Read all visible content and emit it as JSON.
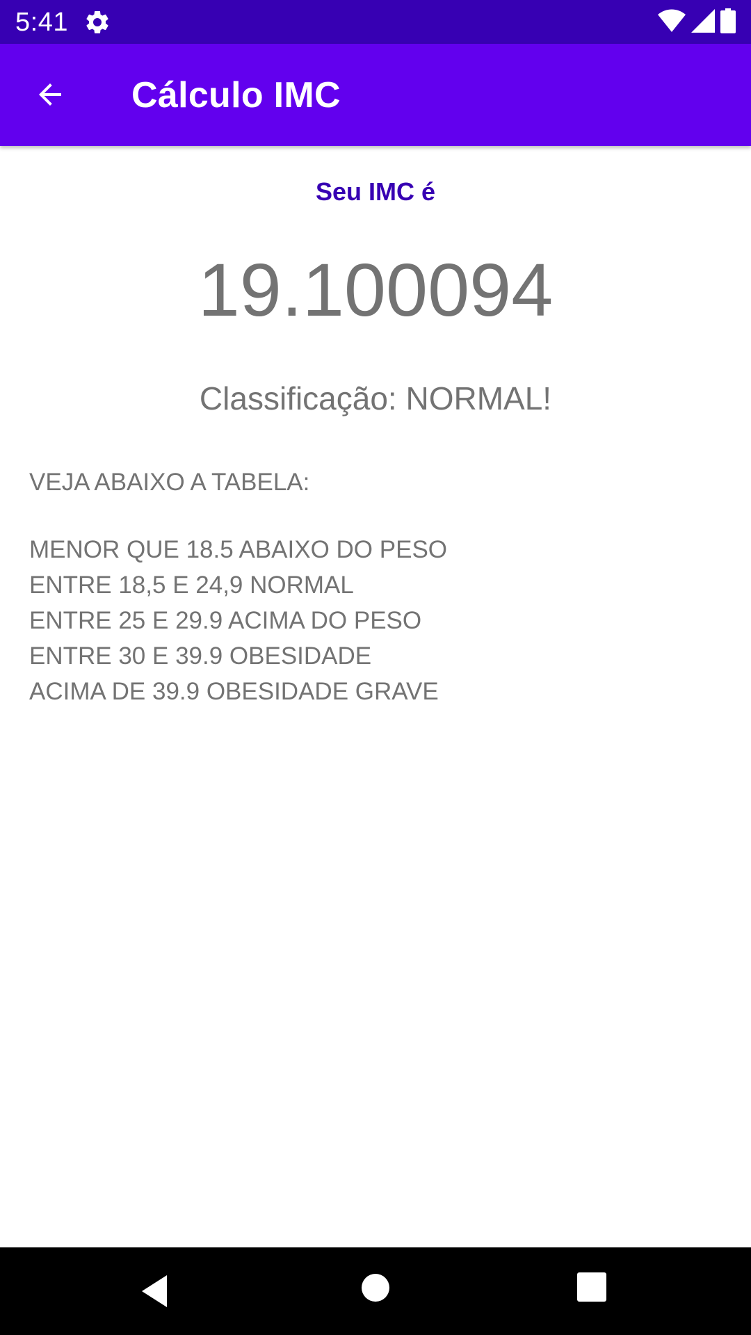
{
  "status_bar": {
    "time": "5:41",
    "icons": [
      "settings-gear-icon",
      "wifi-icon",
      "cell-signal-icon",
      "battery-icon"
    ]
  },
  "app_bar": {
    "title": "Cálculo IMC",
    "back_icon": "arrow-back-icon"
  },
  "result": {
    "label": "Seu IMC é",
    "value": "19.100094",
    "classification": "Classificação: NORMAL!"
  },
  "table": {
    "heading": "VEJA ABAIXO A TABELA:",
    "lines": [
      "MENOR QUE 18.5 ABAIXO DO PESO",
      "ENTRE 18,5 E 24,9 NORMAL",
      "ENTRE 25 E 29.9 ACIMA DO PESO",
      "ENTRE 30 E 39.9 OBESIDADE",
      "ACIMA DE 39.9 OBESIDADE GRAVE"
    ]
  },
  "nav_bar": {
    "icons": [
      "nav-back-icon",
      "nav-home-icon",
      "nav-recents-icon"
    ]
  },
  "colors": {
    "status_bar": "#3700b3",
    "app_bar": "#6200ee",
    "label_accent": "#3700b3",
    "body_text": "#737373"
  }
}
